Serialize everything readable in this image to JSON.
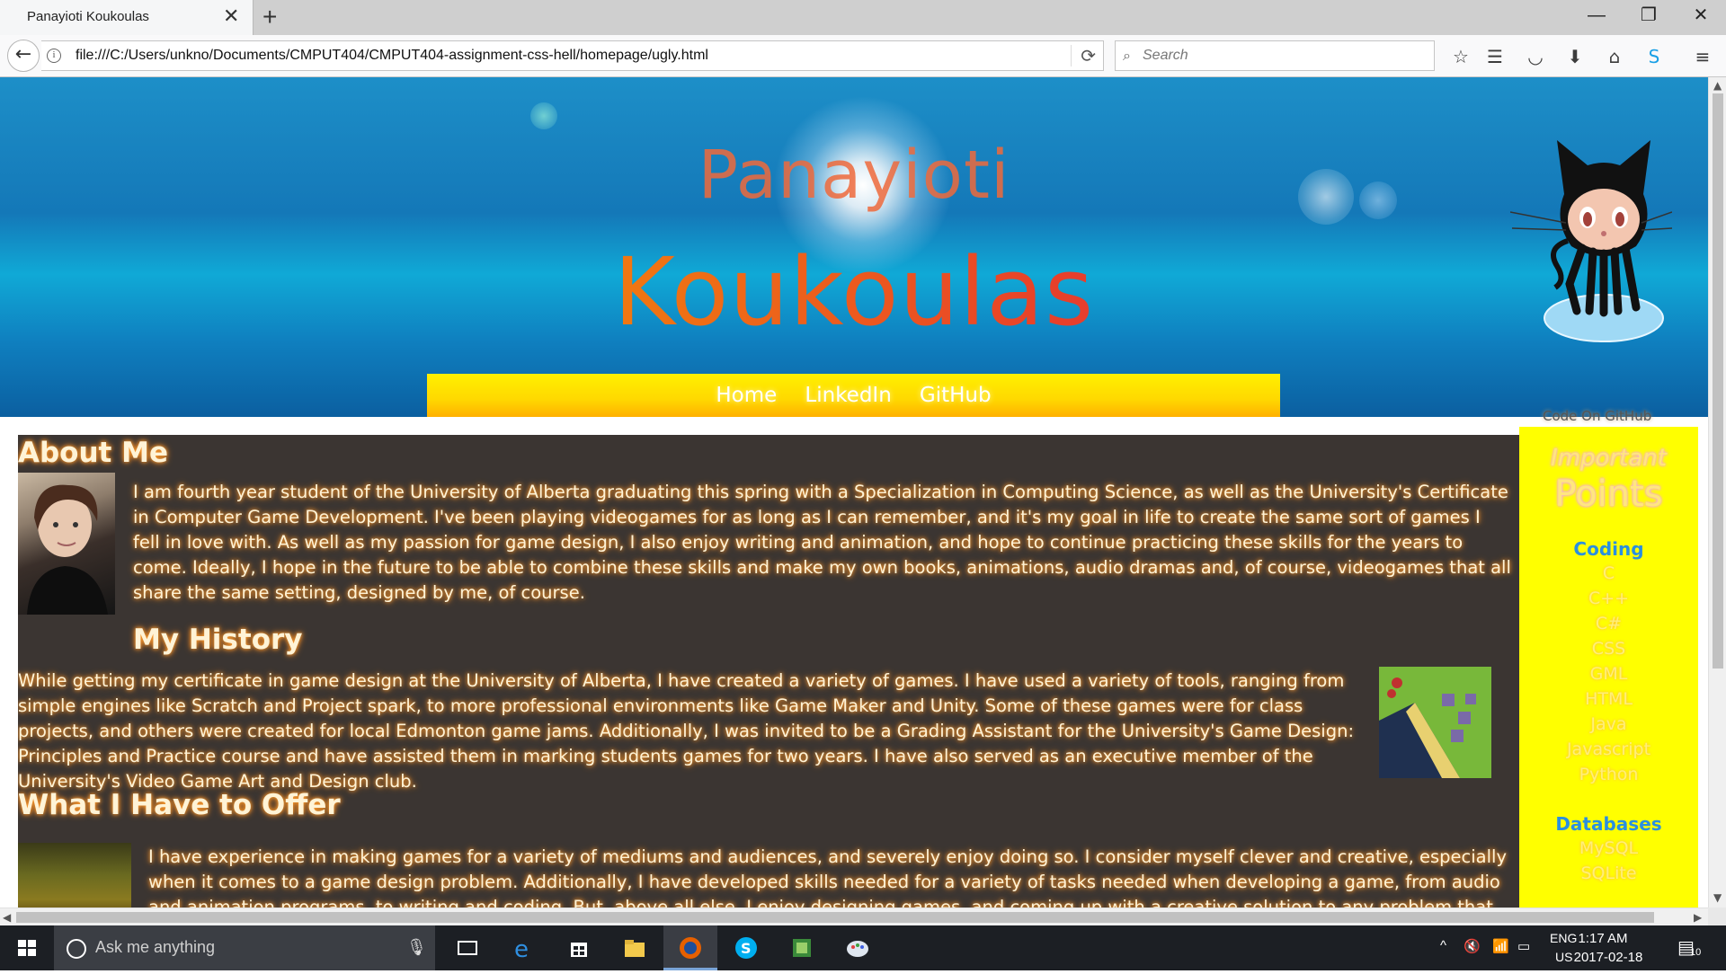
{
  "browser": {
    "tab_title": "Panayioti Koukoulas",
    "tab_close": "✕",
    "new_tab": "+",
    "url": "file:///C:/Users/unkno/Documents/CMPUT404/CMPUT404-assignment-css-hell/homepage/ugly.html",
    "search_placeholder": "Search",
    "window_controls": {
      "minimize": "—",
      "maximize": "❐",
      "close": "✕"
    }
  },
  "header": {
    "first_name": "Panayioti",
    "last_name": "Koukoulas",
    "nav": [
      "Home",
      "LinkedIn",
      "GitHub"
    ],
    "octocat_caption": "Code On GitHub"
  },
  "main": {
    "about_title": "About Me",
    "about_text": "I am fourth year student of the University of Alberta graduating this spring with a Specialization in Computing Science, as well as the University's Certificate in Computer Game Development. I've been playing videogames for as long as I can remember, and it's my goal in life to create the same sort of games I fell in love with. As well as my passion for game design, I also enjoy writing and animation, and hope to continue practicing these skills for the years to come. Ideally, I hope in the future to be able to combine these skills and make my own books, animations, audio dramas and, of course, videogames that all share the same setting, designed by me, of course.",
    "history_title": "My History",
    "history_text": "While getting my certificate in game design at the University of Alberta, I have created a variety of games. I have used a variety of tools, ranging from simple engines like Scratch and Project spark, to more professional environments like Game Maker and Unity. Some of these games were for class projects, and others were created for local Edmonton game jams. Additionally, I was invited to be a Grading Assistant for the University's Game Design: Principles and Practice course and have assisted them in marking students games for two years. I have also served as an executive member of the University's Video Game Art and Design club.",
    "offer_title": "What I Have to Offer",
    "offer_text": "I have experience in making games for a variety of mediums and audiences, and severely enjoy doing so. I consider myself clever and creative, especially when it comes to a game design problem. Additionally, I have developed skills needed for a variety of tasks needed when developing a game, from audio and animation programs, to writing and coding. But, above all else, I enjoy designing games, and coming up with a creative solution to any problem that arises."
  },
  "sidebar": {
    "title_line1": "Important",
    "title_line2": "Points",
    "coding_head": "Coding",
    "coding": [
      "C",
      "C++",
      "C#",
      "CSS",
      "GML",
      "HTML",
      "Java",
      "Javascript",
      "Python"
    ],
    "db_head": "Databases",
    "databases": [
      "MySQL",
      "SQLite"
    ]
  },
  "taskbar": {
    "search_text": "Ask me anything",
    "lang": "ENG",
    "region": "US",
    "time": "1:17 AM",
    "date": "2017-02-18",
    "notifications": "10"
  },
  "colors": {
    "accent_nav": "#ffd800",
    "sidebar_bg": "#ffff00",
    "content_bg": "#3b3532",
    "header_blue": "#1478b8"
  }
}
